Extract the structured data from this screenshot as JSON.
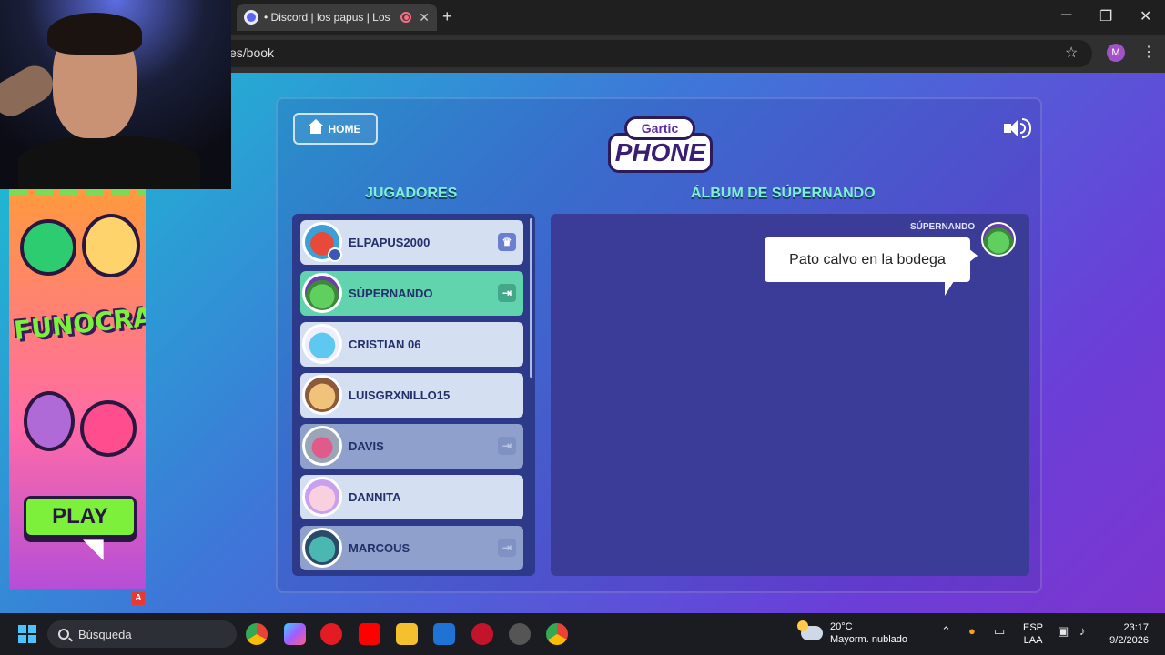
{
  "browser": {
    "tab_title": "• Discord | los papus | Los p",
    "tab_close": "✕",
    "new_tab": "+",
    "url": "es/book",
    "window_controls": {
      "minimize": "─",
      "restore": "❐",
      "close": "✕"
    },
    "profile_initial": "M"
  },
  "ad": {
    "logo_text": "FUNOCRACY",
    "play_label": "PLAY",
    "badge": "A"
  },
  "game": {
    "home_label": "HOME",
    "logo_top": "Gartic",
    "logo_main": "PHONE",
    "players_title": "JUGADORES",
    "album_title": "ÁLBUM DE SÚPERNANDO",
    "players": [
      {
        "name": "ELPAPUS2000",
        "icon": "crown-icon",
        "state": "host"
      },
      {
        "name": "SÚPERNANDO",
        "icon": "exit-icon",
        "state": "active"
      },
      {
        "name": "CRISTIAN 06",
        "icon": "",
        "state": "normal"
      },
      {
        "name": "LUISGRXNILLO15",
        "icon": "",
        "state": "normal"
      },
      {
        "name": "DAVIS",
        "icon": "exit-icon",
        "state": "dim"
      },
      {
        "name": "DANNITA",
        "icon": "",
        "state": "normal"
      },
      {
        "name": "MARCOUS",
        "icon": "exit-icon",
        "state": "dim"
      }
    ],
    "album": {
      "author": "SÚPERNANDO",
      "message": "Pato calvo en la bodega"
    }
  },
  "taskbar": {
    "search_placeholder": "Búsqueda",
    "temperature": "20°C",
    "weather": "Mayorm. nublado",
    "lang_line1": "ESP",
    "lang_line2": "LAA",
    "time": "23:17",
    "date": "9/2/2026"
  },
  "colors": {
    "active_row": "#62d4ad",
    "section_title": "#7ef0d8",
    "album_bg": "#3a3c98"
  }
}
